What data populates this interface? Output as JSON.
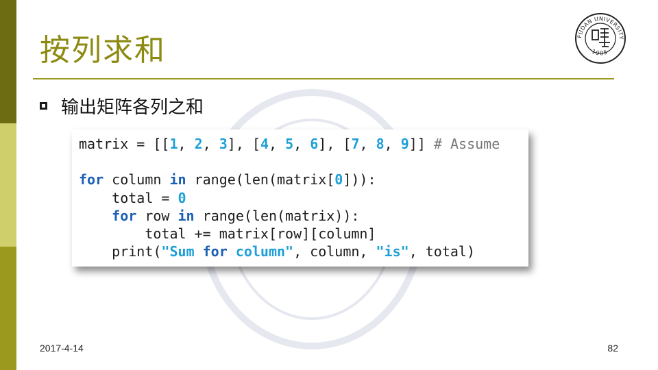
{
  "slide": {
    "title": "按列求和",
    "bullet": "输出矩阵各列之和",
    "date": "2017-4-14",
    "page_number": "82"
  },
  "logo": {
    "text": "FUDAN UNIVERSITY",
    "year": "1905",
    "icon": "fudan-seal"
  },
  "code": {
    "lines": [
      [
        {
          "t": "matrix = [[",
          "c": "plain"
        },
        {
          "t": "1",
          "c": "num"
        },
        {
          "t": ", ",
          "c": "plain"
        },
        {
          "t": "2",
          "c": "num"
        },
        {
          "t": ", ",
          "c": "plain"
        },
        {
          "t": "3",
          "c": "num"
        },
        {
          "t": "], [",
          "c": "plain"
        },
        {
          "t": "4",
          "c": "num"
        },
        {
          "t": ", ",
          "c": "plain"
        },
        {
          "t": "5",
          "c": "num"
        },
        {
          "t": ", ",
          "c": "plain"
        },
        {
          "t": "6",
          "c": "num"
        },
        {
          "t": "], [",
          "c": "plain"
        },
        {
          "t": "7",
          "c": "num"
        },
        {
          "t": ", ",
          "c": "plain"
        },
        {
          "t": "8",
          "c": "num"
        },
        {
          "t": ", ",
          "c": "plain"
        },
        {
          "t": "9",
          "c": "num"
        },
        {
          "t": "]] ",
          "c": "plain"
        },
        {
          "t": "# Assume",
          "c": "cmt"
        }
      ],
      [],
      [
        {
          "t": "for",
          "c": "kw"
        },
        {
          "t": " column ",
          "c": "plain"
        },
        {
          "t": "in",
          "c": "kw"
        },
        {
          "t": " range(len(matrix[",
          "c": "plain"
        },
        {
          "t": "0",
          "c": "num"
        },
        {
          "t": "])):",
          "c": "plain"
        }
      ],
      [
        {
          "t": "    total = ",
          "c": "plain"
        },
        {
          "t": "0",
          "c": "num"
        }
      ],
      [
        {
          "t": "    ",
          "c": "plain"
        },
        {
          "t": "for",
          "c": "kw"
        },
        {
          "t": " row ",
          "c": "plain"
        },
        {
          "t": "in",
          "c": "kw"
        },
        {
          "t": " range(len(matrix)):",
          "c": "plain"
        }
      ],
      [
        {
          "t": "        total += matrix[row][column]",
          "c": "plain"
        }
      ],
      [
        {
          "t": "    print(",
          "c": "plain"
        },
        {
          "t": "\"Sum ",
          "c": "str"
        },
        {
          "t": "for",
          "c": "kw"
        },
        {
          "t": " column\"",
          "c": "str"
        },
        {
          "t": ", column, ",
          "c": "plain"
        },
        {
          "t": "\"is\"",
          "c": "str"
        },
        {
          "t": ", total)",
          "c": "plain"
        }
      ]
    ]
  },
  "colors": {
    "accent": "#8c8a10",
    "band_dark": "#6e6c12",
    "band_light": "#cfcf6b",
    "band_mid": "#9c9a1e",
    "keyword": "#1a5fb4",
    "number": "#1e9fd8"
  }
}
